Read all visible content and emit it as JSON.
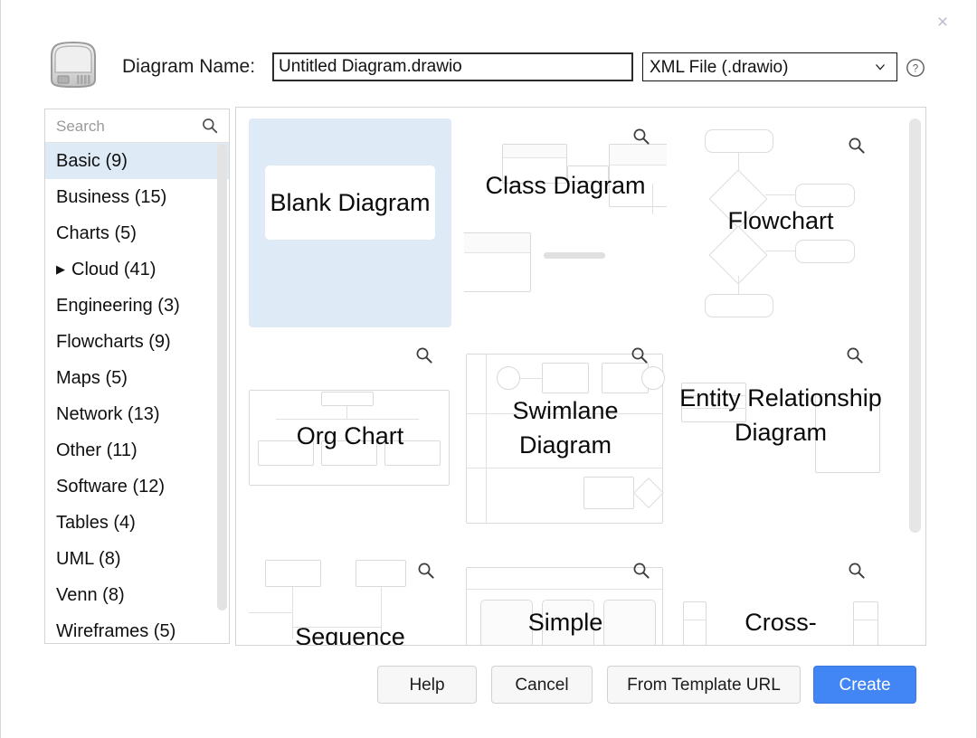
{
  "dialog": {
    "close_label": "×",
    "app_icon": "disk-drive-icon",
    "name_label": "Diagram Name:",
    "name_value": "Untitled Diagram.drawio",
    "name_placeholder": "Untitled Diagram.drawio",
    "file_type": "XML File (.drawio)",
    "help_icon": "question-mark-circle-icon"
  },
  "sidebar": {
    "search_placeholder": "Search",
    "search_value": "",
    "search_icon": "search-icon",
    "categories": [
      {
        "label": "Basic (9)",
        "name": "Basic",
        "count": 9,
        "selected": true,
        "expandable": false
      },
      {
        "label": "Business (15)",
        "name": "Business",
        "count": 15,
        "selected": false,
        "expandable": false
      },
      {
        "label": "Charts (5)",
        "name": "Charts",
        "count": 5,
        "selected": false,
        "expandable": false
      },
      {
        "label": "Cloud (41)",
        "name": "Cloud",
        "count": 41,
        "selected": false,
        "expandable": true
      },
      {
        "label": "Engineering (3)",
        "name": "Engineering",
        "count": 3,
        "selected": false,
        "expandable": false
      },
      {
        "label": "Flowcharts (9)",
        "name": "Flowcharts",
        "count": 9,
        "selected": false,
        "expandable": false
      },
      {
        "label": "Maps (5)",
        "name": "Maps",
        "count": 5,
        "selected": false,
        "expandable": false
      },
      {
        "label": "Network (13)",
        "name": "Network",
        "count": 13,
        "selected": false,
        "expandable": false
      },
      {
        "label": "Other (11)",
        "name": "Other",
        "count": 11,
        "selected": false,
        "expandable": false
      },
      {
        "label": "Software (12)",
        "name": "Software",
        "count": 12,
        "selected": false,
        "expandable": false
      },
      {
        "label": "Tables (4)",
        "name": "Tables",
        "count": 4,
        "selected": false,
        "expandable": false
      },
      {
        "label": "UML (8)",
        "name": "UML",
        "count": 8,
        "selected": false,
        "expandable": false
      },
      {
        "label": "Venn (8)",
        "name": "Venn",
        "count": 8,
        "selected": false,
        "expandable": false
      },
      {
        "label": "Wireframes (5)",
        "name": "Wireframes",
        "count": 5,
        "selected": false,
        "expandable": false
      }
    ],
    "expand_arrow": "▶"
  },
  "templates": {
    "zoom_icon": "magnifier-icon",
    "items": [
      {
        "label": "Blank Diagram",
        "selected": true
      },
      {
        "label": "Class Diagram",
        "selected": false
      },
      {
        "label": "Flowchart",
        "selected": false
      },
      {
        "label": "Org Chart",
        "selected": false
      },
      {
        "label": "Swimlane Diagram",
        "selected": false
      },
      {
        "label": "Entity Relationship Diagram",
        "selected": false
      },
      {
        "label": "Sequence",
        "selected": false
      },
      {
        "label": "Simple",
        "selected": false
      },
      {
        "label": "Cross-",
        "selected": false
      }
    ]
  },
  "footer": {
    "help": "Help",
    "cancel": "Cancel",
    "from_template_url": "From Template URL",
    "create": "Create"
  },
  "colors": {
    "accent": "#4285f4",
    "selection": "#dfeaf7",
    "text": "#101010",
    "border": "#d4d4d4"
  }
}
